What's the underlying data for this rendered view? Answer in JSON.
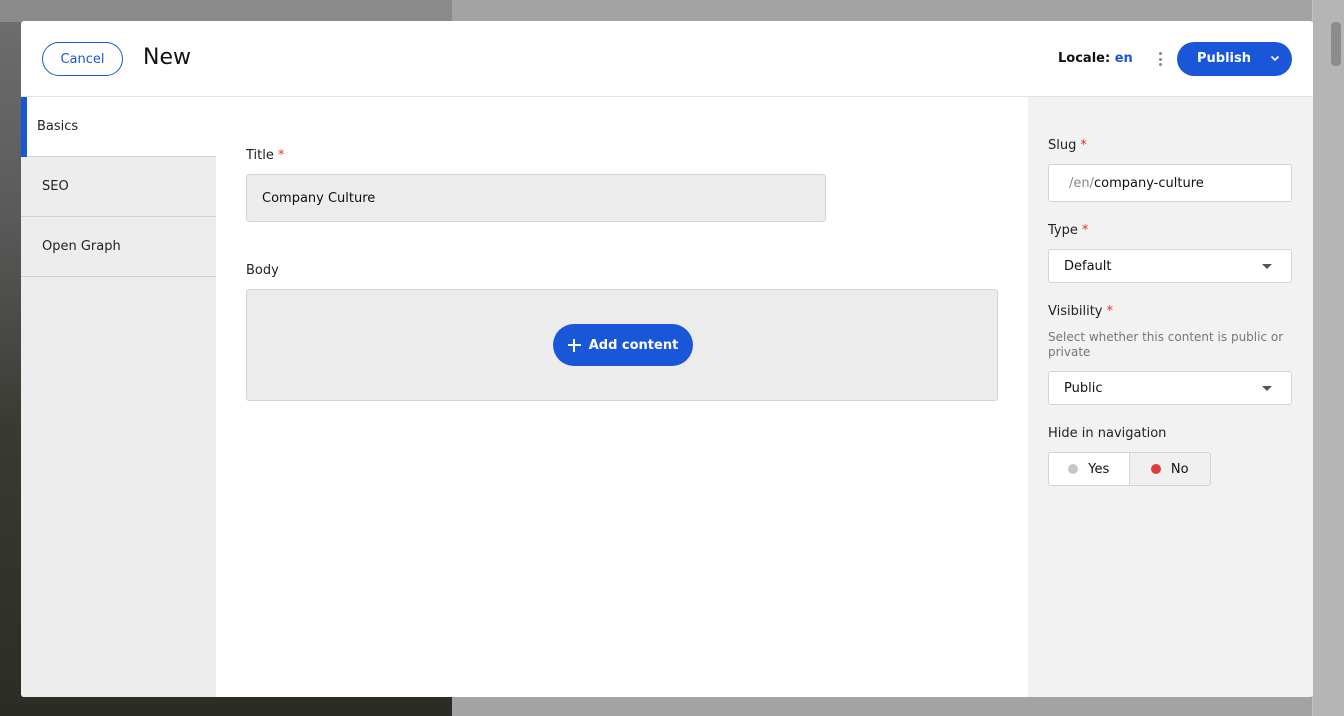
{
  "header": {
    "cancel_label": "Cancel",
    "title": "New",
    "locale_label": "Locale:",
    "locale_value": "en",
    "publish_label": "Publish"
  },
  "sidenav": {
    "items": [
      {
        "label": "Basics",
        "active": true
      },
      {
        "label": "SEO",
        "active": false
      },
      {
        "label": "Open Graph",
        "active": false
      }
    ]
  },
  "main": {
    "title_label": "Title",
    "title_value": "Company Culture",
    "body_label": "Body",
    "add_content_label": "Add content",
    "required_mark": "*"
  },
  "sidebar": {
    "slug_label": "Slug",
    "slug_prefix": "/en/",
    "slug_value": "company-culture",
    "type_label": "Type",
    "type_value": "Default",
    "visibility_label": "Visibility",
    "visibility_help": "Select whether this content is public or private",
    "visibility_value": "Public",
    "hide_nav_label": "Hide in navigation",
    "hide_nav_options": [
      "Yes",
      "No"
    ],
    "hide_nav_selected": "No"
  },
  "colors": {
    "accent": "#1a57d8",
    "required": "#dd3333",
    "toggle_selected": "#e03b3b"
  }
}
